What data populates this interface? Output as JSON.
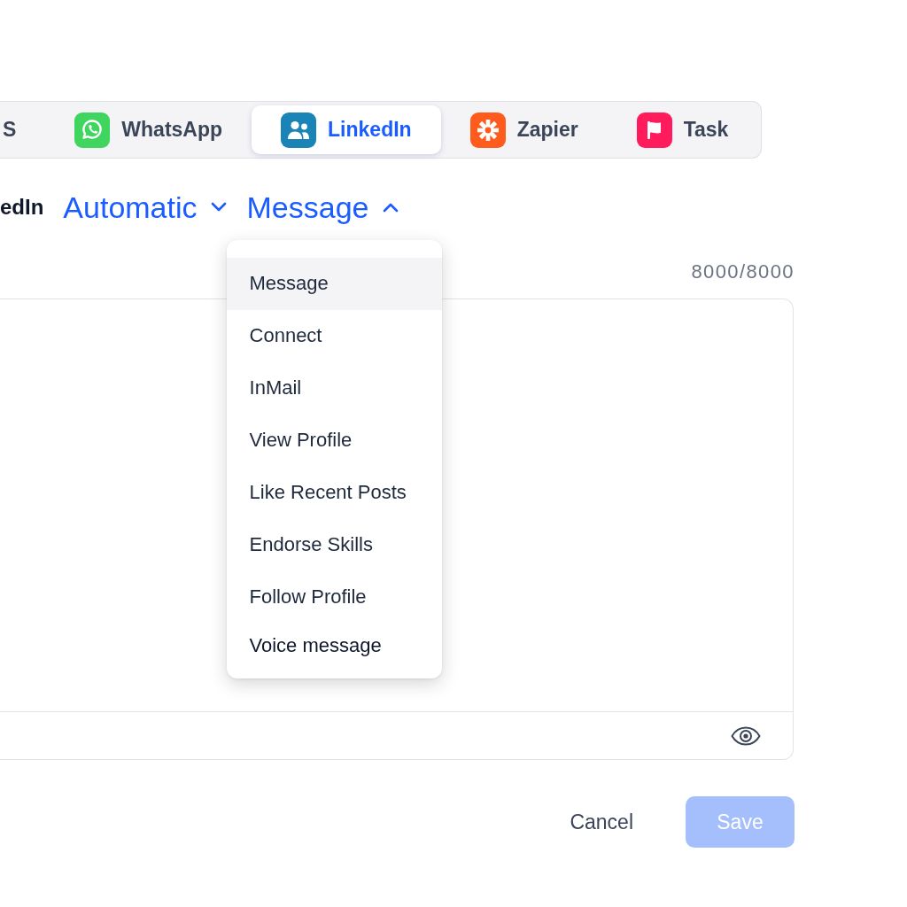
{
  "tabs": [
    {
      "label": "S",
      "kind": "plain",
      "selected": false
    },
    {
      "label": "WhatsApp",
      "kind": "chat",
      "color": "#3fd55e",
      "selected": false
    },
    {
      "label": "LinkedIn",
      "kind": "people",
      "color": "#1a84b6",
      "selected": true
    },
    {
      "label": "Zapier",
      "kind": "asterisk",
      "color": "#ff5b1c",
      "selected": false
    },
    {
      "label": "Task",
      "kind": "flag",
      "color": "#ff1b5c",
      "selected": false
    }
  ],
  "heading": {
    "title": "edIn",
    "selects": [
      {
        "value": "Automatic",
        "expanded": false
      },
      {
        "value": "Message",
        "expanded": true,
        "options": [
          {
            "label": "Message",
            "selected": true
          },
          {
            "label": "Connect",
            "selected": false
          },
          {
            "label": "InMail",
            "selected": false
          },
          {
            "label": "View Profile",
            "selected": false
          },
          {
            "label": "Like Recent Posts",
            "selected": false
          },
          {
            "label": "Endorse Skills",
            "selected": false
          },
          {
            "label": "Follow Profile",
            "selected": false
          },
          {
            "label": "Voice message",
            "selected": false
          }
        ]
      }
    ]
  },
  "editor": {
    "counter": "8000/8000"
  },
  "buttons": [
    {
      "label": "Cancel",
      "kind": "secondary",
      "disabled": false
    },
    {
      "label": "Save",
      "kind": "primary",
      "disabled": true
    }
  ]
}
